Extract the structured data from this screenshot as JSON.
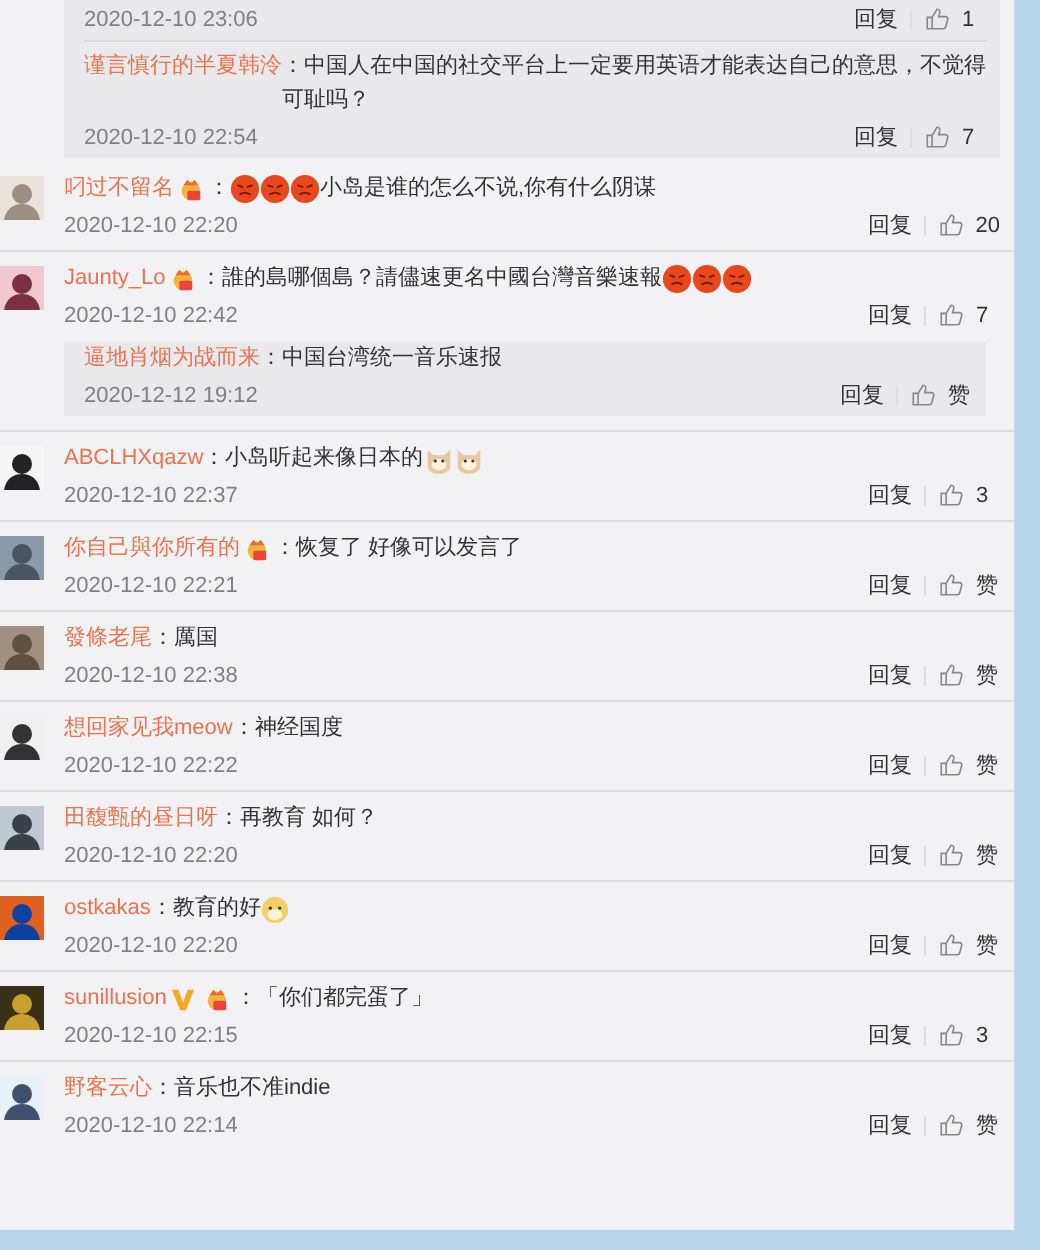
{
  "top_replies": [
    {
      "time": "2020-12-10 23:06",
      "reply": "回复",
      "likes": "1"
    },
    {
      "name": "谨言慎行的半夏韩泠",
      "parts": [
        {
          "kind": "text",
          "text": "：中国人在中国的社交平台上一定要用英语才能表达自己的意思，不觉得可耻吗？"
        }
      ],
      "time": "2020-12-10 22:54",
      "reply": "回复",
      "likes": "7"
    }
  ],
  "comments": [
    {
      "name": "叼过不留名",
      "badges": [
        {
          "kind": "fan"
        }
      ],
      "parts": [
        {
          "kind": "text",
          "text": "："
        },
        {
          "kind": "angry"
        },
        {
          "kind": "angry"
        },
        {
          "kind": "angry"
        },
        {
          "kind": "text",
          "text": "小岛是谁的怎么不说,你有什么阴谋"
        }
      ],
      "time": "2020-12-10 22:20",
      "reply": "回复",
      "likes": "20"
    },
    {
      "name": "Jaunty_Lo",
      "badges": [
        {
          "kind": "fan"
        }
      ],
      "parts": [
        {
          "kind": "text",
          "text": "：誰的島哪個島？請儘速更名中國台灣音樂速報"
        },
        {
          "kind": "angry"
        },
        {
          "kind": "angry"
        },
        {
          "kind": "angry"
        }
      ],
      "time": "2020-12-10 22:42",
      "reply": "回复",
      "likes": "7",
      "replies": [
        {
          "name": "逼地肖烟为战而来",
          "parts": [
            {
              "kind": "text",
              "text": "：中国台湾统一音乐速报"
            }
          ],
          "time": "2020-12-12 19:12",
          "reply": "回复",
          "likes": "赞"
        }
      ]
    },
    {
      "name": "ABCLHXqazw",
      "parts": [
        {
          "kind": "text",
          "text": "：小岛听起来像日本的"
        },
        {
          "kind": "cat"
        },
        {
          "kind": "cat"
        }
      ],
      "time": "2020-12-10 22:37",
      "reply": "回复",
      "likes": "3"
    },
    {
      "name": "你自己與你所有的",
      "badges": [
        {
          "kind": "fan"
        }
      ],
      "parts": [
        {
          "kind": "text",
          "text": "：恢复了 好像可以发言了"
        }
      ],
      "time": "2020-12-10 22:21",
      "reply": "回复",
      "likes": "赞"
    },
    {
      "name": "發條老尾",
      "parts": [
        {
          "kind": "text",
          "text": "：厲国"
        }
      ],
      "time": "2020-12-10 22:38",
      "reply": "回复",
      "likes": "赞"
    },
    {
      "name": "想回家见我meow",
      "parts": [
        {
          "kind": "text",
          "text": "：神经国度"
        }
      ],
      "time": "2020-12-10 22:22",
      "reply": "回复",
      "likes": "赞"
    },
    {
      "name": "田馥甄的昼日呀",
      "parts": [
        {
          "kind": "text",
          "text": "：再教育 如何？"
        }
      ],
      "time": "2020-12-10 22:20",
      "reply": "回复",
      "likes": "赞"
    },
    {
      "name": "ostkakas",
      "parts": [
        {
          "kind": "text",
          "text": "：教育的好"
        },
        {
          "kind": "dog"
        }
      ],
      "time": "2020-12-10 22:20",
      "reply": "回复",
      "likes": "赞"
    },
    {
      "name": "sunillusion",
      "badges": [
        {
          "kind": "vip"
        },
        {
          "kind": "fan"
        }
      ],
      "parts": [
        {
          "kind": "text",
          "text": "：「你们都完蛋了」"
        }
      ],
      "time": "2020-12-10 22:15",
      "reply": "回复",
      "likes": "3"
    },
    {
      "name": "野客云心",
      "parts": [
        {
          "kind": "text",
          "text": "：音乐也不准indie"
        }
      ],
      "time": "2020-12-10 22:14",
      "reply": "回复",
      "likes": "赞"
    }
  ]
}
